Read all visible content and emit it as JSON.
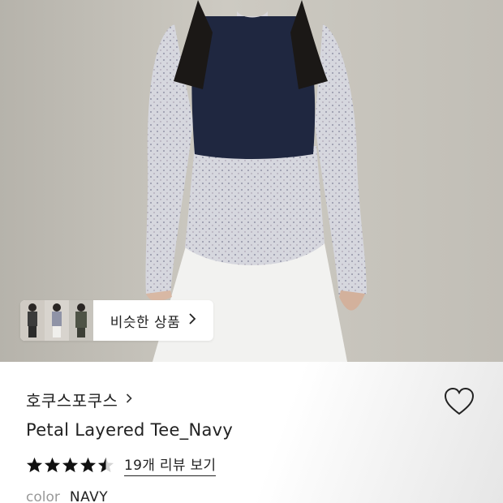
{
  "hero": {
    "similar_products_label": "비슷한 상품",
    "similar_products_icon": "chevron-right-icon"
  },
  "product": {
    "brand": "호쿠스포쿠스",
    "brand_icon": "chevron-right-icon",
    "name": "Petal Layered Tee_Navy",
    "rating": 4.5,
    "rating_max": 5,
    "review_link": "19개 리뷰 보기",
    "wishlist_icon": "heart-outline-icon",
    "color_label": "color",
    "color_value": "NAVY"
  },
  "colors": {
    "text": "#222222",
    "muted": "#999999",
    "star": "#111111"
  }
}
